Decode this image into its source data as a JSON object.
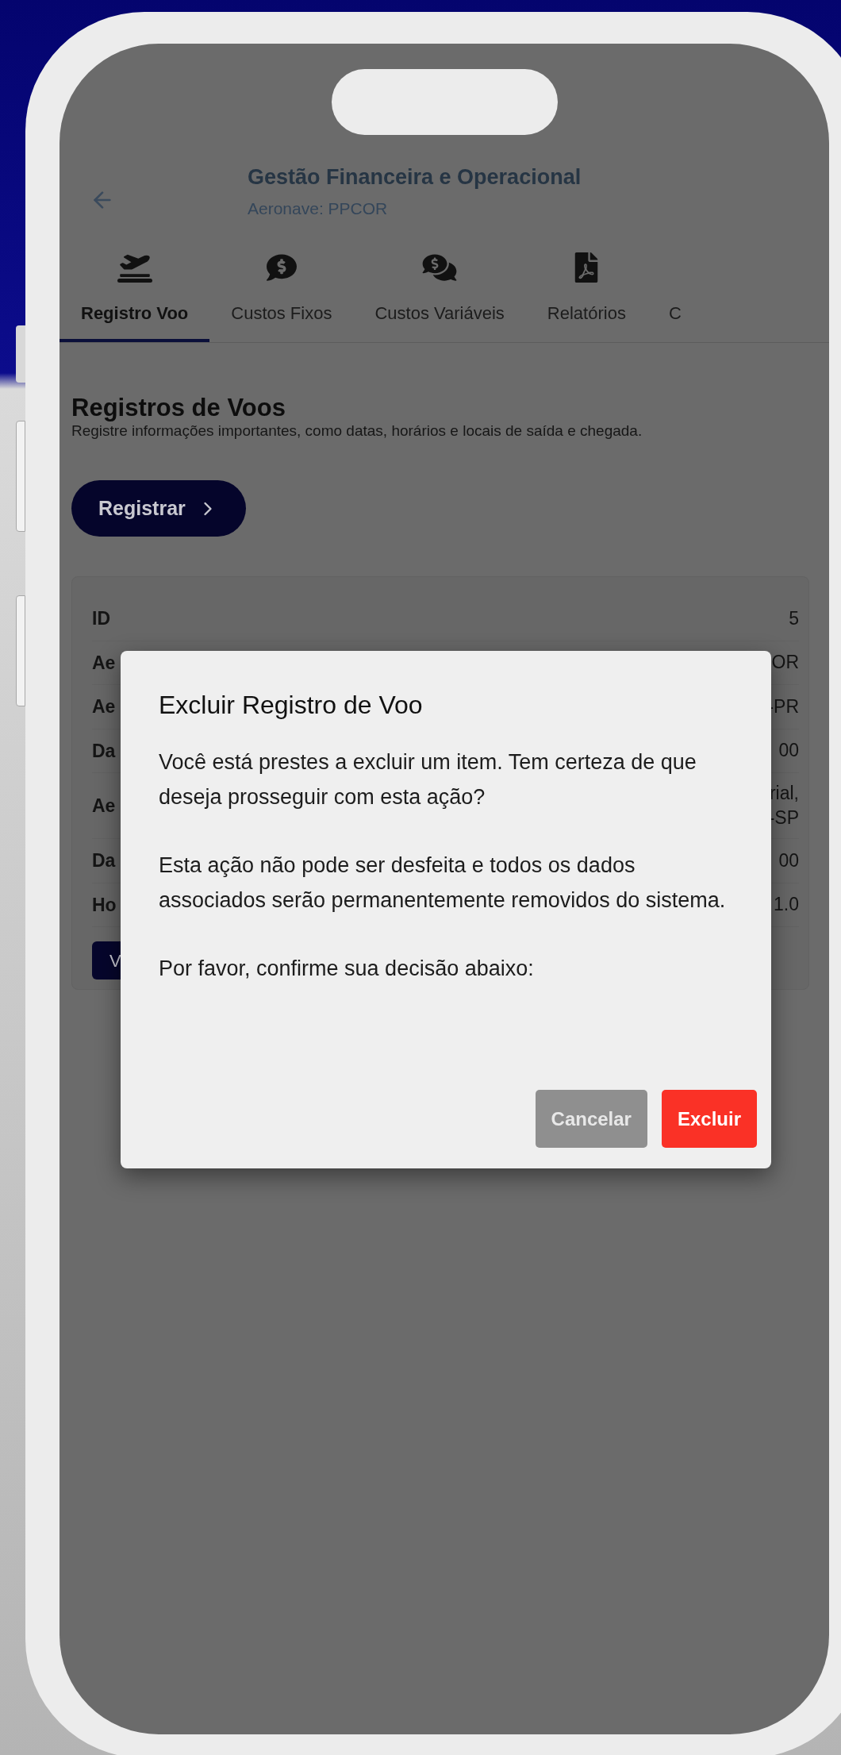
{
  "header": {
    "title": "Gestão Financeira e Operacional",
    "subtitle": "Aeronave: PPCOR"
  },
  "tabs": [
    {
      "label": "Registro Voo",
      "kind": "flight",
      "selected": true
    },
    {
      "label": "Custos Fixos",
      "kind": "cost",
      "selected": false
    },
    {
      "label": "Custos Variáveis",
      "kind": "costs",
      "selected": false
    },
    {
      "label": "Relatórios",
      "kind": "pdf",
      "selected": false
    },
    {
      "label": "C",
      "selected": false
    }
  ],
  "section": {
    "heading": "Registros de Voos",
    "description": "Registre informações importantes, como datas, horários e locais de saída e chegada.",
    "register_button": "Registrar"
  },
  "card": {
    "rows": [
      {
        "label": "ID",
        "value": "5"
      },
      {
        "label": "Ae",
        "value": "OR"
      },
      {
        "label": "Ae",
        "value": "-PR"
      },
      {
        "label": "Da",
        "value": "00"
      },
      {
        "label": "Ae",
        "value": "rial,\n-SP"
      },
      {
        "label": "Da",
        "value": "00"
      },
      {
        "label": "Ho",
        "value": "1.0"
      }
    ],
    "button": "V"
  },
  "dialog": {
    "title": "Excluir Registro de Voo",
    "paragraphs": [
      "Você está prestes a excluir um item. Tem certeza de que deseja prosseguir com esta ação?",
      "Esta ação não pode ser desfeita e todos os dados associados serão permanentemente removidos do sistema.",
      "Por favor, confirme sua decisão abaixo:"
    ],
    "buttons": [
      {
        "label": "Cancelar",
        "kind": "secondary"
      },
      {
        "label": "Excluir",
        "kind": "danger"
      }
    ]
  }
}
